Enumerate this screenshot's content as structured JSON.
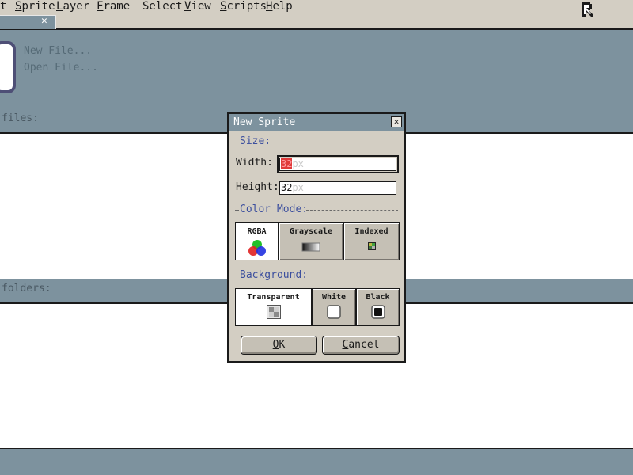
{
  "menubar": {
    "items": [
      {
        "label": "t",
        "underline_first": false
      },
      {
        "label": "Sprite",
        "underline_first": true
      },
      {
        "label": "Layer",
        "underline_first": true
      },
      {
        "label": "Frame",
        "underline_first": true
      },
      {
        "label": "Select",
        "underline_first": false
      },
      {
        "label": "View",
        "underline_first": true
      },
      {
        "label": "Scripts",
        "underline_first": true
      },
      {
        "label": "Help",
        "underline_first": true
      }
    ]
  },
  "tab": {
    "close_glyph": "✕"
  },
  "home": {
    "new_file": "New File...",
    "open_file": "Open File...",
    "recent_files_label": "files:",
    "recent_folders_label": "folders:"
  },
  "dialog": {
    "title": "New Sprite",
    "close_glyph": "✕",
    "size_header": "Size:",
    "width_label": "Width:",
    "width_value": "32",
    "width_unit": "px",
    "height_label": "Height:",
    "height_value": "32",
    "height_unit": "px",
    "color_mode_header": "Color Mode:",
    "color_modes": [
      "RGBA",
      "Grayscale",
      "Indexed"
    ],
    "selected_color_mode": "RGBA",
    "background_header": "Background:",
    "backgrounds": [
      "Transparent",
      "White",
      "Black"
    ],
    "selected_background": "Transparent",
    "ok_label": "OK",
    "cancel_label": "Cancel"
  },
  "colors": {
    "accent_blue": "#3c4f9e",
    "panel": "#7d929e",
    "face": "#d3cec3",
    "selection_red": "#e03a3a"
  }
}
